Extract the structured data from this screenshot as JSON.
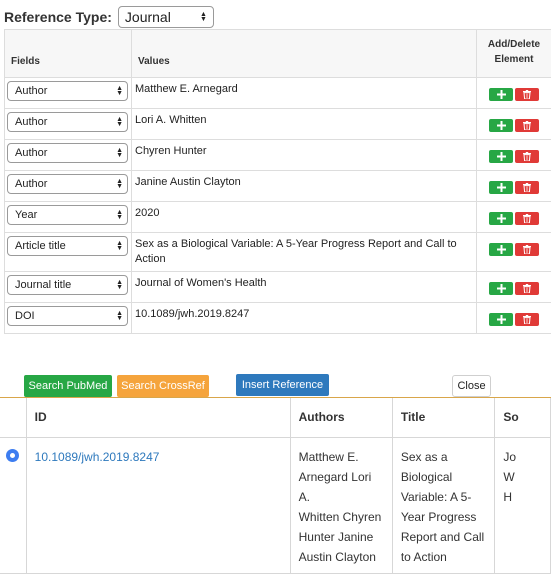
{
  "reference_type": {
    "label": "Reference Type:",
    "value": "Journal"
  },
  "fields_table": {
    "headers": {
      "fields": "Fields",
      "values": "Values",
      "add_delete_line1": "Add/Delete",
      "add_delete_line2": "Element"
    },
    "rows": [
      {
        "field": "Author",
        "value": "Matthew E. Arnegard"
      },
      {
        "field": "Author",
        "value": "Lori A. Whitten"
      },
      {
        "field": "Author",
        "value": "Chyren Hunter"
      },
      {
        "field": "Author",
        "value": "Janine Austin Clayton"
      },
      {
        "field": "Year",
        "value": "2020"
      },
      {
        "field": "Article title",
        "value": "Sex as a Biological Variable: A 5-Year Progress Report and Call to Action"
      },
      {
        "field": "Journal title",
        "value": "Journal of Women's Health"
      },
      {
        "field": "DOI",
        "value": "10.1089/jwh.2019.8247"
      }
    ]
  },
  "buttons": {
    "search_pubmed": "Search PubMed",
    "search_crossref": "Search CrossRef",
    "insert_reference": "Insert Reference",
    "close": "Close"
  },
  "results_table": {
    "headers": {
      "id": "ID",
      "authors": "Authors",
      "title": "Title",
      "source": "So"
    },
    "rows": [
      {
        "selected": true,
        "id": "10.1089/jwh.2019.8247",
        "authors_lines": [
          "Matthew E.",
          "Arnegard  Lori",
          "A.",
          "Whitten  Chyren",
          "Hunter  Janine",
          "Austin Clayton"
        ],
        "title_lines": [
          "Sex as a",
          "Biological",
          "Variable: A 5-",
          "Year Progress",
          "Report and Call",
          "to Action"
        ],
        "source_lines": [
          "Jo",
          "W",
          "H"
        ]
      }
    ]
  },
  "colors": {
    "add_button": "#27a745",
    "delete_button": "#e03a37",
    "pubmed": "#27a745",
    "crossref": "#f5a43c",
    "insert": "#2e79bd",
    "link": "#2e79bd",
    "radio": "#3d7df0"
  },
  "icons": {
    "add": "plus-icon",
    "delete": "trash-icon",
    "select": "up-down-arrows-icon"
  }
}
